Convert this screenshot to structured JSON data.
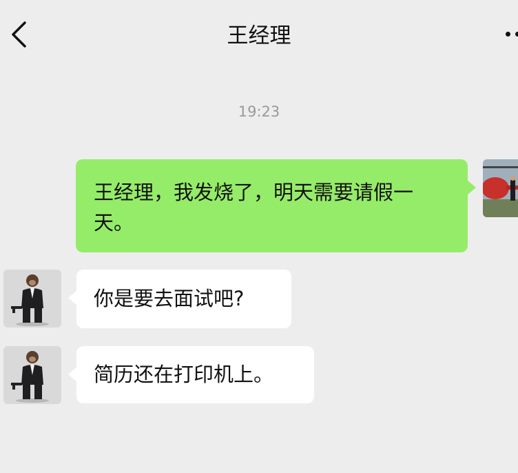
{
  "header": {
    "title": "王经理"
  },
  "chat": {
    "timestamp": "19:23",
    "messages": [
      {
        "sender": "me",
        "text": "王经理，我发烧了，明天需要请假一天。"
      },
      {
        "sender": "contact",
        "text": "你是要去面试吧?"
      },
      {
        "sender": "contact",
        "text": "简历还在打印机上。"
      }
    ]
  },
  "icons": {
    "back": "chevron-left-icon",
    "more": "more-dots-icon"
  },
  "colors": {
    "background": "#ededed",
    "sent_bubble": "#95ec69",
    "received_bubble": "#ffffff",
    "timestamp": "#9a9a9a"
  }
}
